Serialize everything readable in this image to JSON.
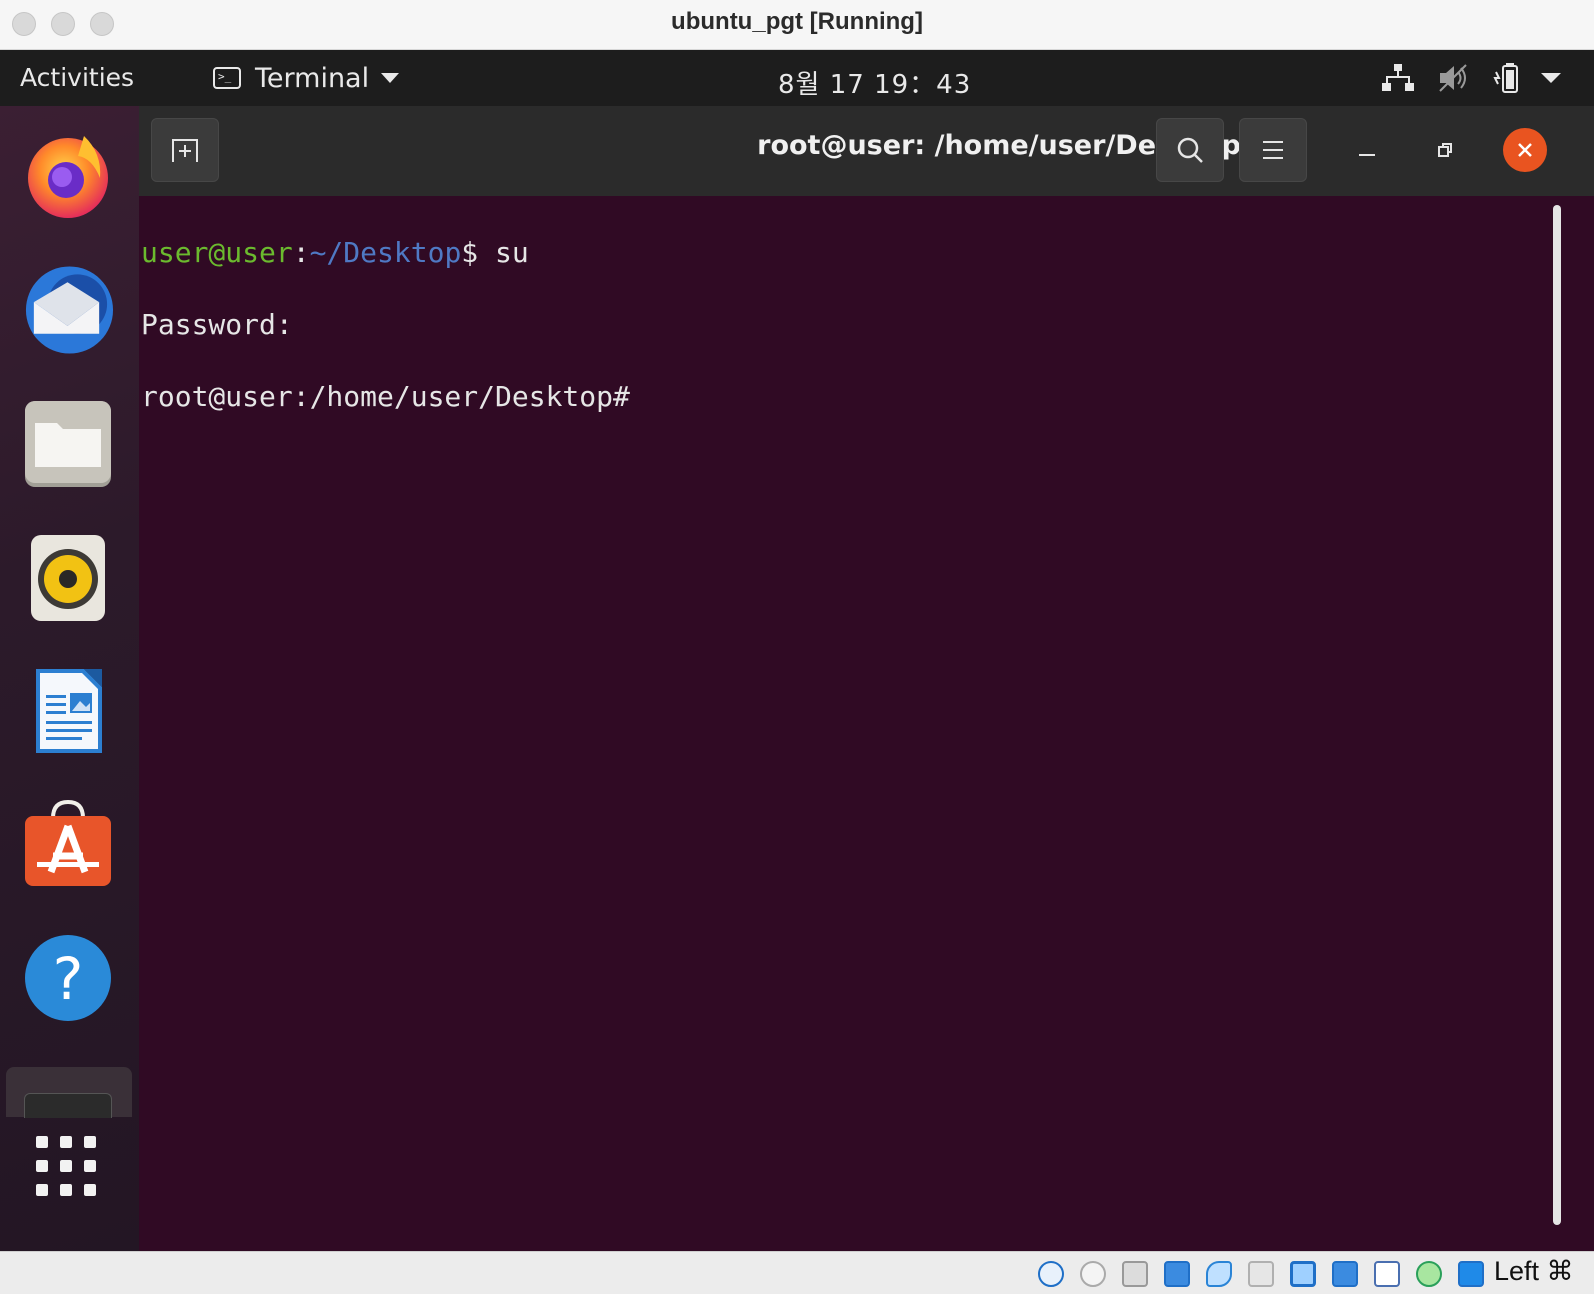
{
  "window": {
    "title": "ubuntu_pgt [Running]"
  },
  "topbar": {
    "activities": "Activities",
    "app_name": "Terminal",
    "clock": "8월 17  19：43",
    "icons": [
      "network-icon",
      "volume-muted-icon",
      "battery-icon",
      "system-menu-arrow-icon"
    ]
  },
  "dock": {
    "items": [
      "Firefox",
      "Thunderbird",
      "Files",
      "Rhythmbox",
      "LibreOffice Writer",
      "Ubuntu Software",
      "Help",
      "Terminal",
      "Show Applications"
    ]
  },
  "terminal": {
    "title": "root@user: /home/user/Desktop",
    "lines": {
      "l1_user": "user@user",
      "l1_colon": ":",
      "l1_path": "~/Desktop",
      "l1_cmd": "$ su",
      "l2": "Password:",
      "l3": "root@user:/home/user/Desktop#"
    },
    "colors": {
      "background": "#300a24",
      "prompt_user": "#6bba2e",
      "prompt_path": "#4f79c4"
    }
  },
  "statusbar": {
    "host_key": "Left ⌘",
    "icons": [
      "hard-disk-icon",
      "optical-drive-icon",
      "audio-icon",
      "network-adapter-icon",
      "usb-icon",
      "shared-folder-icon",
      "display-icon",
      "screen-capture-icon",
      "video-capture-icon",
      "cpu-icon",
      "guest-additions-icon",
      "download-icon"
    ]
  }
}
